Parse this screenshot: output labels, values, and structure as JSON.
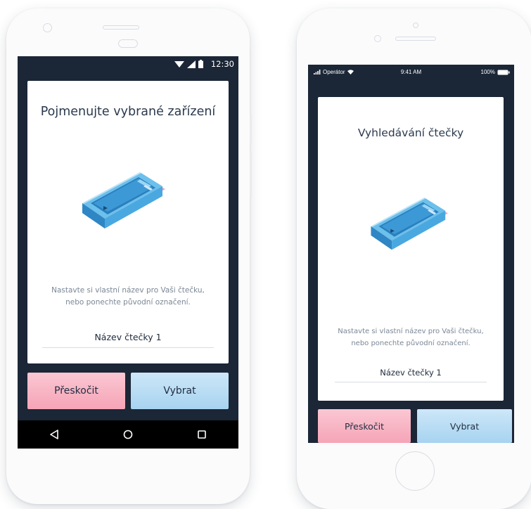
{
  "android": {
    "status_time": "12:30",
    "card_title": "Pojmenujte vybrané zařízení",
    "description_line1": "Nastavte si vlastní název pro Vaši čtečku,",
    "description_line2": "nebo ponechte původní označení.",
    "reader_name_value": "Název čtečky 1",
    "skip_label": "Přeskočit",
    "select_label": "Vybrat",
    "nav_icons": [
      "back-icon",
      "home-icon",
      "recents-icon"
    ]
  },
  "ios": {
    "carrier": "Operátor",
    "status_time": "9:41 AM",
    "battery_percent": "100%",
    "card_title": "Vyhledávání čtečky",
    "description_line1": "Nastavte si vlastní název pro Vaši čtečku,",
    "description_line2": "nebo ponechte původní označení.",
    "reader_name_value": "Název čtečky 1",
    "skip_label": "Přeskočit",
    "select_label": "Vybrat"
  },
  "colors": {
    "screen_bg": "#1b2636",
    "skip_pink": "#f7b3c3",
    "select_blue": "#b7dcf3",
    "title_text": "#2b3a4e",
    "reader_blue": "#4aa8e0",
    "reader_pink": "#f2a5bb"
  }
}
